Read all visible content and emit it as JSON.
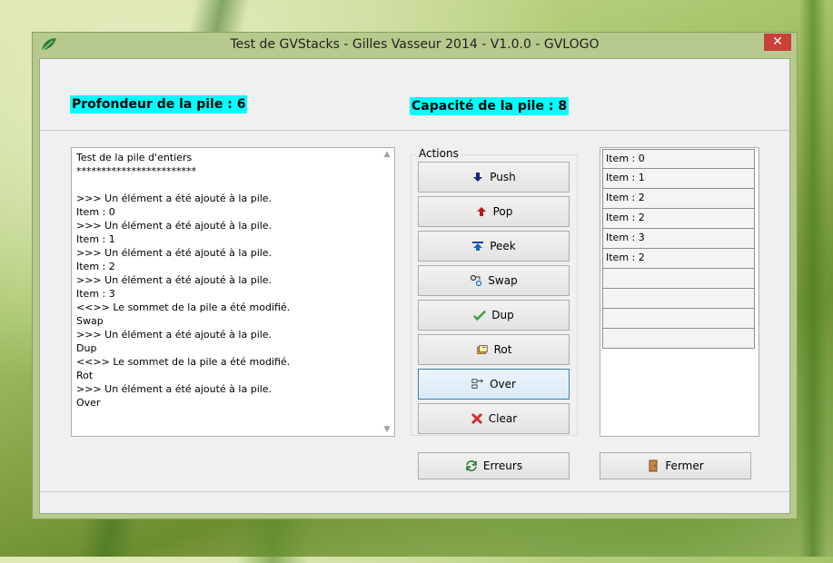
{
  "window": {
    "title": "Test de GVStacks - Gilles Vasseur 2014 - V1.0.0 - GVLOGO",
    "close_glyph": "✕"
  },
  "header": {
    "depth_label": "Profondeur de la pile : 6",
    "capacity_label": "Capacité de la pile : 8"
  },
  "log": {
    "lines": "Test de la pile d'entiers\n************************\n\n>>> Un élément a été ajouté à la pile.\nItem : 0\n>>> Un élément a été ajouté à la pile.\nItem : 1\n>>> Un élément a été ajouté à la pile.\nItem : 2\n>>> Un élément a été ajouté à la pile.\nItem : 3\n<<>> Le sommet de la pile a été modifié.\nSwap\n>>> Un élément a été ajouté à la pile.\nDup\n<<>> Le sommet de la pile a été modifié.\nRot\n>>> Un élément a été ajouté à la pile.\nOver"
  },
  "actions": {
    "legend": "Actions",
    "push": {
      "label": "Push",
      "icon": "arrow-down-icon"
    },
    "pop": {
      "label": "Pop",
      "icon": "arrow-up-icon"
    },
    "peek": {
      "label": "Peek",
      "icon": "peek-icon"
    },
    "swap": {
      "label": "Swap",
      "icon": "swap-icon"
    },
    "dup": {
      "label": "Dup",
      "icon": "check-icon"
    },
    "rot": {
      "label": "Rot",
      "icon": "rotate-icon"
    },
    "over": {
      "label": "Over",
      "icon": "over-icon"
    },
    "clear": {
      "label": "Clear",
      "icon": "cross-icon"
    }
  },
  "stack_list": {
    "items": [
      "Item : 0",
      "Item : 1",
      "Item : 2",
      "Item : 2",
      "Item : 3",
      "Item : 2",
      "",
      "",
      "",
      ""
    ]
  },
  "footer": {
    "errors_label": "Erreurs",
    "close_label": "Fermer"
  },
  "colors": {
    "highlight": "#00ffff",
    "close_button": "#c7403a",
    "focus_border": "#3c7fb1"
  }
}
